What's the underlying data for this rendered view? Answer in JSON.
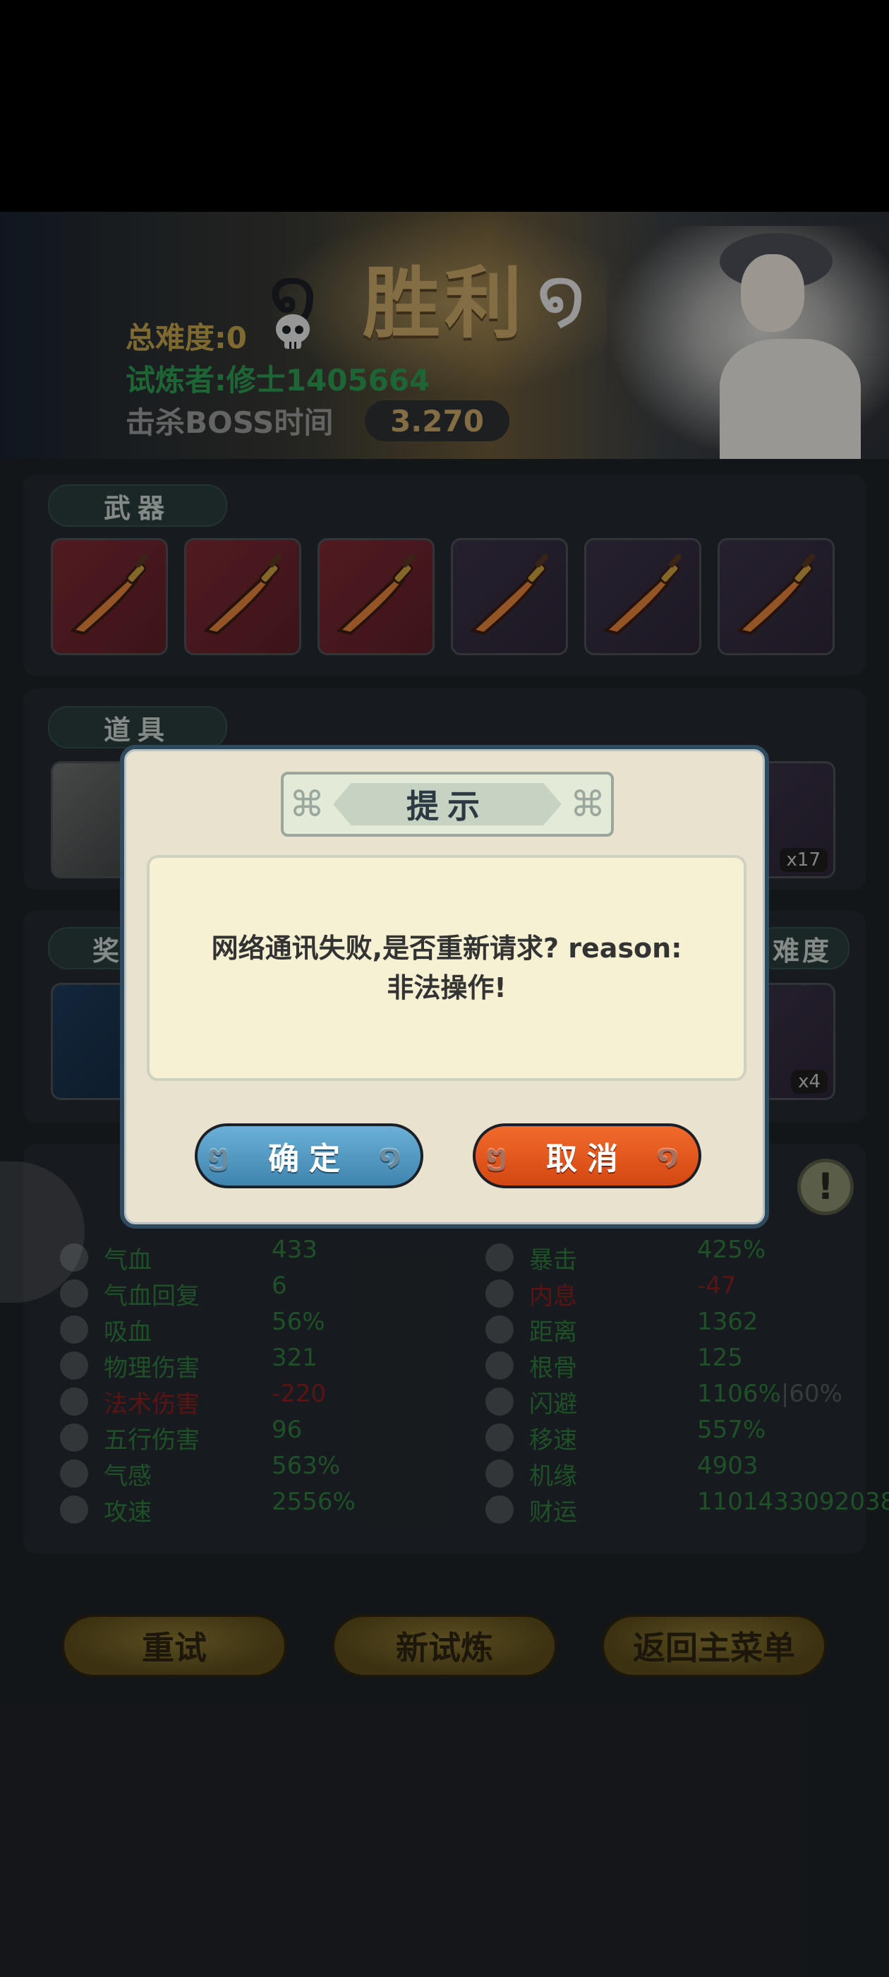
{
  "banner": {
    "title": "胜利",
    "difficulty": "总难度:0",
    "trainer": "试炼者:修士1405664",
    "boss_time_label": "击杀BOSS时间",
    "boss_time_value": "3.270"
  },
  "sections": {
    "weapons": "武器",
    "items": "道具",
    "rewards_partial": "奖",
    "difficulty_partial": "难度"
  },
  "weapons": [
    {
      "rarity": "red"
    },
    {
      "rarity": "red"
    },
    {
      "rarity": "red"
    },
    {
      "rarity": "purple"
    },
    {
      "rarity": "purple"
    },
    {
      "rarity": "purple"
    }
  ],
  "items": {
    "last_count": "x17"
  },
  "rewards": {
    "last_count": "x4"
  },
  "stats_left": [
    {
      "icon": "heart-icon",
      "label": "气血",
      "value": "433",
      "negative": false
    },
    {
      "icon": "heart-regen-icon",
      "label": "气血回复",
      "value": "6",
      "negative": false
    },
    {
      "icon": "drop-icon",
      "label": "吸血",
      "value": "56%",
      "negative": false
    },
    {
      "icon": "sword-small-icon",
      "label": "物理伤害",
      "value": "321",
      "negative": false
    },
    {
      "icon": "spiral-icon",
      "label": "法术伤害",
      "value": "-220",
      "negative": true
    },
    {
      "icon": "five-elements-icon",
      "label": "五行伤害",
      "value": "96",
      "negative": false
    },
    {
      "icon": "qi-icon",
      "label": "气感",
      "value": "563%",
      "negative": false
    },
    {
      "icon": "attack-speed-icon",
      "label": "攻速",
      "value": "2556%",
      "negative": false
    }
  ],
  "stats_right": [
    {
      "icon": "crit-icon",
      "label": "暴击",
      "value": "425%",
      "negative": false,
      "suffix": ""
    },
    {
      "icon": "hammer-icon",
      "label": "内息",
      "value": "-47",
      "negative": true,
      "suffix": ""
    },
    {
      "icon": "target-icon",
      "label": "距离",
      "value": "1362",
      "negative": false,
      "suffix": ""
    },
    {
      "icon": "person-icon",
      "label": "根骨",
      "value": "125",
      "negative": false,
      "suffix": ""
    },
    {
      "icon": "dodge-icon",
      "label": "闪避",
      "value": "1106%",
      "negative": false,
      "suffix": "|60%"
    },
    {
      "icon": "boot-icon",
      "label": "移速",
      "value": "557%",
      "negative": false,
      "suffix": ""
    },
    {
      "icon": "luck-icon",
      "label": "机缘",
      "value": "4903",
      "negative": false,
      "suffix": ""
    },
    {
      "icon": "coin-icon",
      "label": "财运",
      "value": "1101433092038",
      "negative": false,
      "suffix": ""
    }
  ],
  "bottom_buttons": {
    "retry": "重试",
    "new_trial": "新试炼",
    "main_menu": "返回主菜单"
  },
  "dialog": {
    "title": "提示",
    "message": "网络通讯失败,是否重新请求? reason:非法操作!",
    "confirm": "确定",
    "cancel": "取消"
  },
  "colors": {
    "confirm_button": "#4f97c2",
    "cancel_button": "#e85a1c",
    "stat_green": "#2f7d3e",
    "gold": "#c9a86a"
  }
}
